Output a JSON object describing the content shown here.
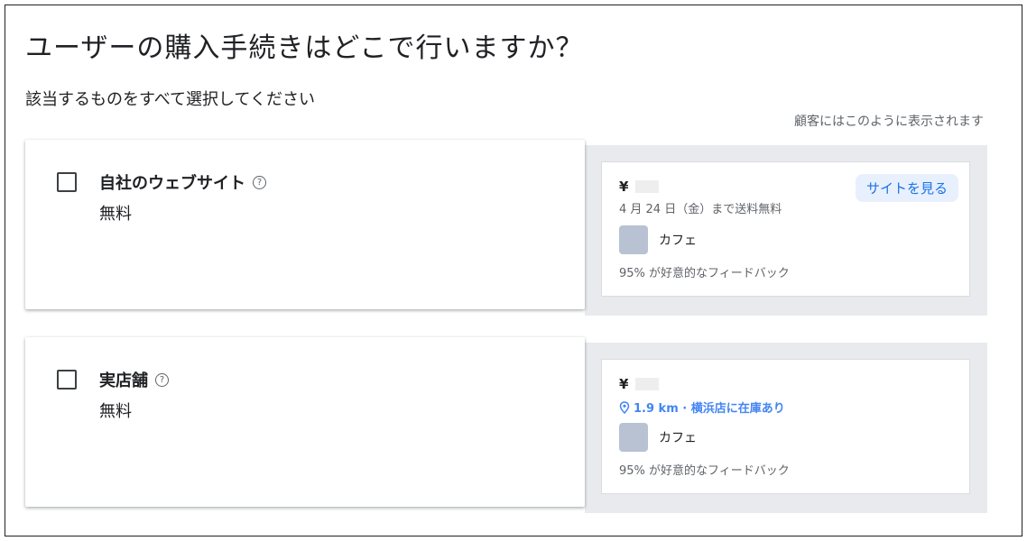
{
  "page_title": "ユーザーの購入手続きはどこで行いますか？",
  "subtitle": "該当するものをすべて選択してください",
  "preview_note": "顧客にはこのように表示されます",
  "options": [
    {
      "label": "自社のウェブサイト",
      "price": "無料",
      "checked": false,
      "preview": {
        "currency": "¥",
        "shipping": "4 月 24 日（金）まで送料無料",
        "button_label": "サイトを見る",
        "merchant": "カフェ",
        "feedback": "95% が好意的なフィードバック"
      }
    },
    {
      "label": "実店舗",
      "price": "無料",
      "checked": false,
      "preview": {
        "currency": "¥",
        "stock": "1.9 km · 横浜店に在庫あり",
        "merchant": "カフェ",
        "feedback": "95% が好意的なフィードバック"
      }
    }
  ],
  "icons": {
    "help": "help-circle-icon",
    "pin": "location-pin-icon"
  },
  "colors": {
    "link_blue": "#1a73e8",
    "stock_blue": "#4285f4",
    "preview_bg": "#e8eaed",
    "button_bg": "#e8f0fe",
    "merchant_logo": "#b8c2d3"
  }
}
